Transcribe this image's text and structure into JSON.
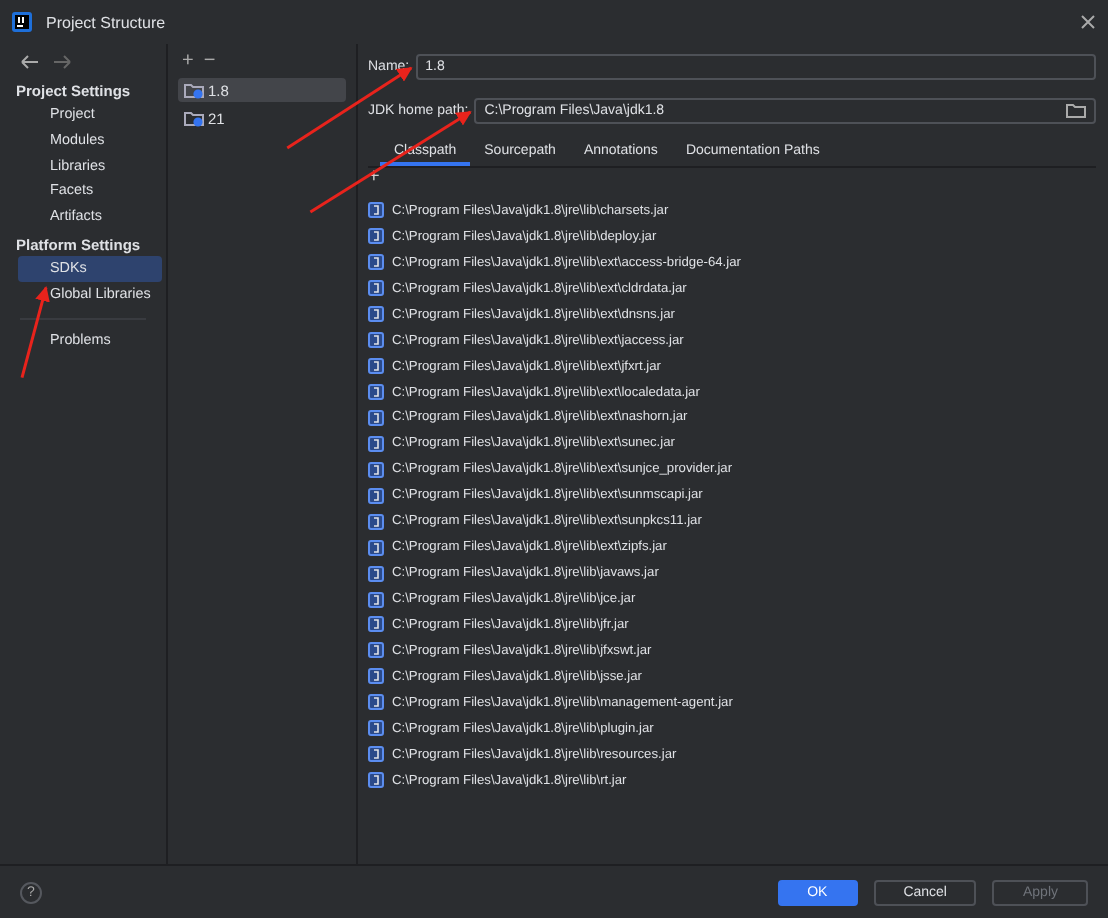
{
  "window": {
    "title": "Project Structure"
  },
  "sidebar": {
    "sections": [
      {
        "heading": "Project Settings",
        "items": [
          {
            "label": "Project",
            "selected": false
          },
          {
            "label": "Modules",
            "selected": false
          },
          {
            "label": "Libraries",
            "selected": false
          },
          {
            "label": "Facets",
            "selected": false
          },
          {
            "label": "Artifacts",
            "selected": false
          }
        ]
      },
      {
        "heading": "Platform Settings",
        "items": [
          {
            "label": "SDKs",
            "selected": true
          },
          {
            "label": "Global Libraries",
            "selected": false
          }
        ]
      }
    ],
    "extra_items": [
      {
        "label": "Problems",
        "selected": false
      }
    ]
  },
  "sdk_list": {
    "toolbar": [
      "+",
      "−"
    ],
    "items": [
      {
        "label": "1.8",
        "selected": true
      },
      {
        "label": "21",
        "selected": false
      }
    ]
  },
  "name_field": {
    "label": "Name:",
    "value": "1.8"
  },
  "home_path_field": {
    "label": "JDK home path:",
    "value": "C:\\Program Files\\Java\\jdk1.8"
  },
  "tabs": [
    {
      "label": "Classpath",
      "selected": true
    },
    {
      "label": "Sourcepath",
      "selected": false
    },
    {
      "label": "Annotations",
      "selected": false
    },
    {
      "label": "Documentation Paths",
      "selected": false
    }
  ],
  "classpath_toolbar": [
    "+"
  ],
  "classpath": [
    "C:\\Program Files\\Java\\jdk1.8\\jre\\lib\\charsets.jar",
    "C:\\Program Files\\Java\\jdk1.8\\jre\\lib\\deploy.jar",
    "C:\\Program Files\\Java\\jdk1.8\\jre\\lib\\ext\\access-bridge-64.jar",
    "C:\\Program Files\\Java\\jdk1.8\\jre\\lib\\ext\\cldrdata.jar",
    "C:\\Program Files\\Java\\jdk1.8\\jre\\lib\\ext\\dnsns.jar",
    "C:\\Program Files\\Java\\jdk1.8\\jre\\lib\\ext\\jaccess.jar",
    "C:\\Program Files\\Java\\jdk1.8\\jre\\lib\\ext\\jfxrt.jar",
    "C:\\Program Files\\Java\\jdk1.8\\jre\\lib\\ext\\localedata.jar",
    "C:\\Program Files\\Java\\jdk1.8\\jre\\lib\\ext\\nashorn.jar",
    "C:\\Program Files\\Java\\jdk1.8\\jre\\lib\\ext\\sunec.jar",
    "C:\\Program Files\\Java\\jdk1.8\\jre\\lib\\ext\\sunjce_provider.jar",
    "C:\\Program Files\\Java\\jdk1.8\\jre\\lib\\ext\\sunmscapi.jar",
    "C:\\Program Files\\Java\\jdk1.8\\jre\\lib\\ext\\sunpkcs11.jar",
    "C:\\Program Files\\Java\\jdk1.8\\jre\\lib\\ext\\zipfs.jar",
    "C:\\Program Files\\Java\\jdk1.8\\jre\\lib\\javaws.jar",
    "C:\\Program Files\\Java\\jdk1.8\\jre\\lib\\jce.jar",
    "C:\\Program Files\\Java\\jdk1.8\\jre\\lib\\jfr.jar",
    "C:\\Program Files\\Java\\jdk1.8\\jre\\lib\\jfxswt.jar",
    "C:\\Program Files\\Java\\jdk1.8\\jre\\lib\\jsse.jar",
    "C:\\Program Files\\Java\\jdk1.8\\jre\\lib\\management-agent.jar",
    "C:\\Program Files\\Java\\jdk1.8\\jre\\lib\\plugin.jar",
    "C:\\Program Files\\Java\\jdk1.8\\jre\\lib\\resources.jar",
    "C:\\Program Files\\Java\\jdk1.8\\jre\\lib\\rt.jar"
  ],
  "footer": {
    "help": "?",
    "buttons": [
      {
        "label": "OK",
        "kind": "primary"
      },
      {
        "label": "Cancel",
        "kind": "normal"
      },
      {
        "label": "Apply",
        "kind": "disabled"
      }
    ]
  },
  "annotation_arrows": [
    {
      "kind": "name"
    },
    {
      "kind": "path"
    },
    {
      "kind": "sidebar"
    }
  ]
}
